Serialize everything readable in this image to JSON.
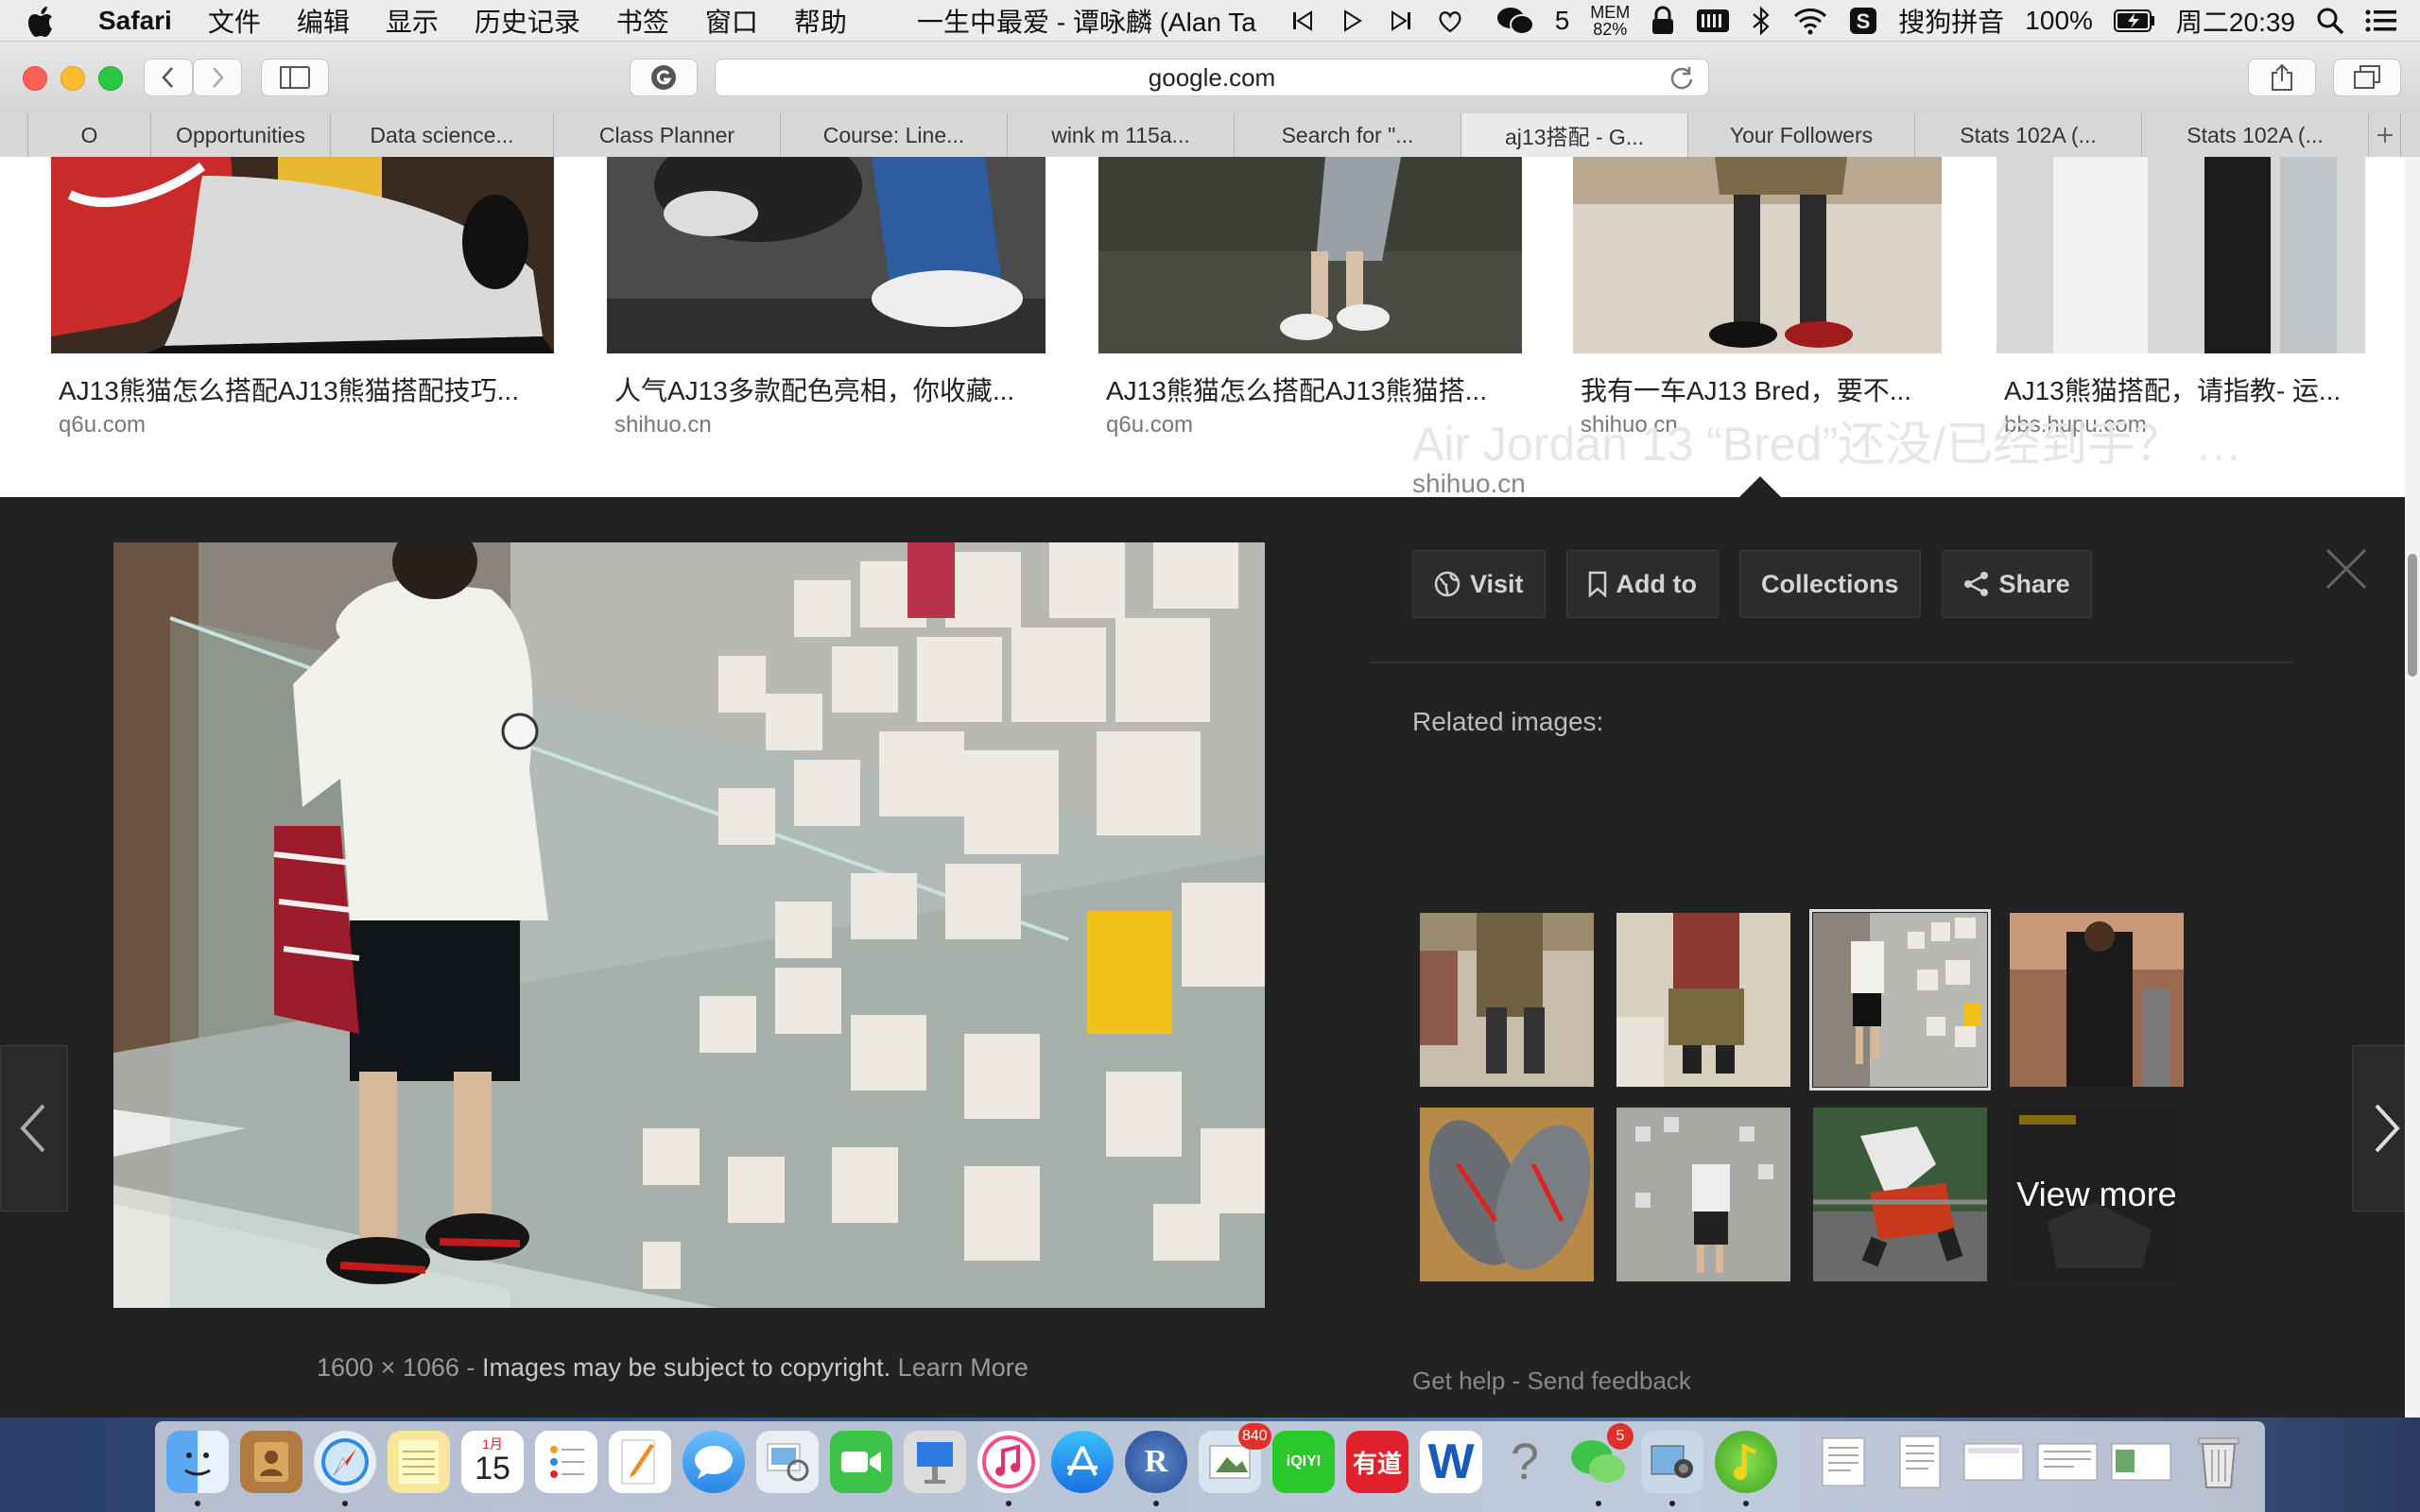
{
  "menubar": {
    "app": "Safari",
    "menus": [
      "文件",
      "编辑",
      "显示",
      "历史记录",
      "书签",
      "窗口",
      "帮助"
    ],
    "now_playing": "一生中最爱 - 谭咏麟 (Alan Ta",
    "wechat_count": "5",
    "mem_label": "MEM",
    "mem_value": "82%",
    "input_method": "搜狗拼音",
    "battery": "100%",
    "clock": "周二20:39"
  },
  "toolbar": {
    "url": "google.com"
  },
  "tabs": [
    {
      "label": "O"
    },
    {
      "label": "Opportunities"
    },
    {
      "label": "Data science..."
    },
    {
      "label": "Class Planner"
    },
    {
      "label": "Course: Line..."
    },
    {
      "label": "wink m 115a..."
    },
    {
      "label": "Search for \"..."
    },
    {
      "label": "aj13搭配 - G..."
    },
    {
      "label": "Your Followers"
    },
    {
      "label": "Stats 102A (..."
    },
    {
      "label": "Stats 102A (..."
    }
  ],
  "results": [
    {
      "title": "AJ13熊猫怎么搭配AJ13熊猫搭配技巧...",
      "source": "q6u.com"
    },
    {
      "title": "人气AJ13多款配色亮相，你收藏...",
      "source": "shihuo.cn"
    },
    {
      "title": "AJ13熊猫怎么搭配AJ13熊猫搭...",
      "source": "q6u.com"
    },
    {
      "title": "我有一车AJ13 Bred，要不...",
      "source": "shihuo.cn"
    },
    {
      "title": "AJ13熊猫搭配，请指教- 运...",
      "source": "bbs.hupu.com"
    }
  ],
  "detail": {
    "title": "Air Jordan 13 “Bred”还没/已经到手？ …",
    "source": "shihuo.cn",
    "actions": {
      "visit": "Visit",
      "add_to": "Add to",
      "collections": "Collections",
      "share": "Share"
    },
    "related_label": "Related images:",
    "view_more": "View more",
    "dimensions": "1600 × 1066",
    "sep": "-",
    "copyright": "Images may be subject to copyright.",
    "learn_more": "Learn More",
    "get_help": "Get help",
    "send_feedback": "Send feedback"
  },
  "dock": {
    "calendar_day": "15",
    "calendar_month": "1月",
    "itunes_badge": "840",
    "wechat_badge": "5",
    "youdao": "有道",
    "word": "W",
    "help": "?",
    "iqiyi": "iQIYI",
    "r_label": "R"
  },
  "colors": {
    "panel_bg": "#222222",
    "accent_yellow": "#f2c21a",
    "link_gray": "#888888"
  }
}
